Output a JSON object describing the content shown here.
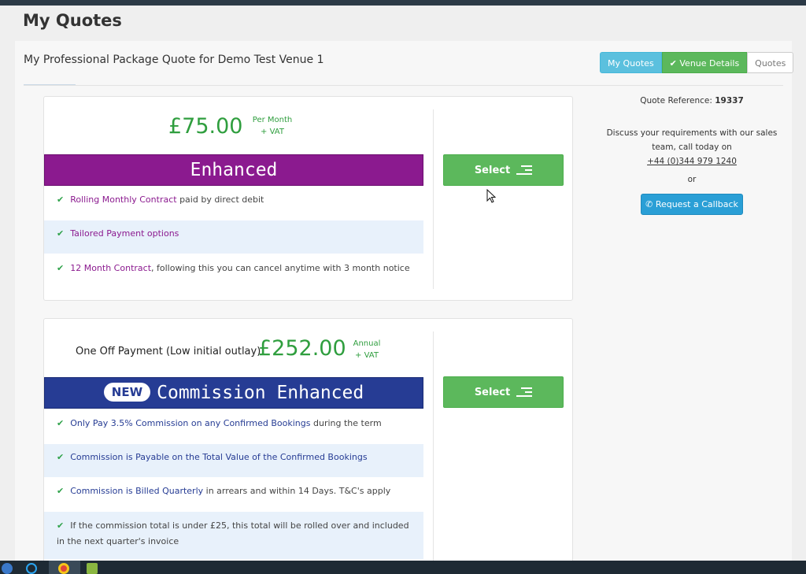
{
  "page": {
    "title": "My Quotes"
  },
  "panel": {
    "title": "My Professional Package Quote for Demo Test Venue 1",
    "nav": {
      "my_quotes": "My Quotes",
      "venue_details": "Venue Details",
      "quotes": "Quotes"
    }
  },
  "quote1": {
    "price": "£75.00",
    "period": "Per Month",
    "vat": "+ VAT",
    "package": "Enhanced",
    "features": [
      {
        "highlight": "Rolling Monthly Contract",
        "text": " paid by direct debit"
      },
      {
        "highlight": "Tailored Payment options",
        "text": ""
      },
      {
        "highlight": "12 Month Contract",
        "text": ", following this you can cancel anytime with 3 month notice"
      }
    ],
    "select_label": "Select"
  },
  "quote2": {
    "label": "One Off Payment (Low initial outlay)",
    "price": "£252.00",
    "period": "Annual",
    "vat": "+ VAT",
    "badge": "NEW",
    "package": "Commission Enhanced",
    "features": [
      {
        "highlight": "Only Pay 3.5% Commission on any Confirmed Bookings",
        "text": " during the term"
      },
      {
        "highlight": "Commission is Payable on the Total Value of the Confirmed Bookings",
        "text": ""
      },
      {
        "highlight": "Commission is Billed Quarterly",
        "text": " in arrears and within 14 Days. T&C's apply"
      },
      {
        "highlight": "",
        "text": "If the commission total is under £25, this total will be rolled over and included in the next quarter's invoice"
      }
    ],
    "select_label": "Select"
  },
  "sidebar": {
    "ref_label": "Quote Reference: ",
    "ref_value": "19337",
    "discuss_line1": "Discuss your requirements with our sales",
    "discuss_line2": "team, call today on",
    "phone": "+44 (0)344 979 1240",
    "or": "or",
    "callback_label": "Request a Callback"
  },
  "colors": {
    "price_green": "#2f9e3e",
    "enhanced_purple": "#8b1a8f",
    "commission_blue": "#263c94",
    "select_green": "#5cb85c",
    "info_blue": "#2a9fd6"
  }
}
